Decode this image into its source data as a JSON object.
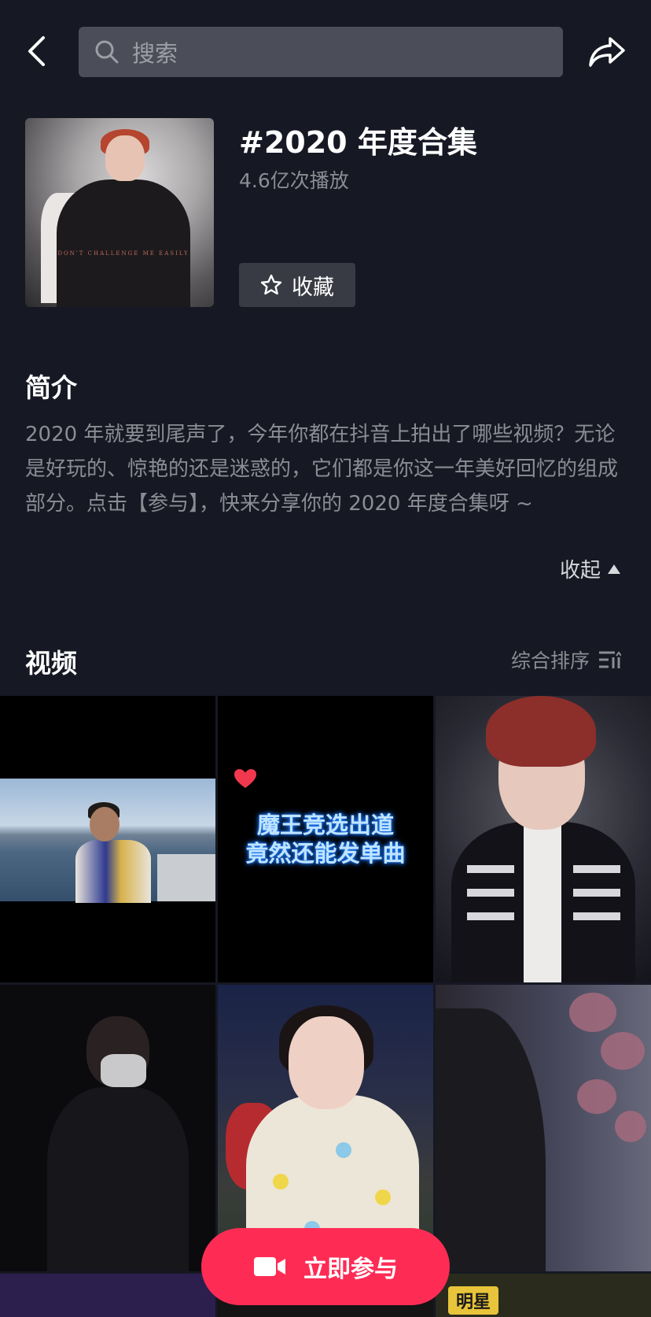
{
  "header": {
    "back_icon": "chevron-left-icon",
    "search_placeholder": "搜索",
    "share_icon": "share-arrow-icon"
  },
  "topic": {
    "title": "#2020 年度合集",
    "plays": "4.6亿次播放",
    "favorite_label": "收藏",
    "cover_tagline": "DON'T CHALLENGE ME EASILY"
  },
  "intro": {
    "heading": "简介",
    "text": "2020 年就要到尾声了，今年你都在抖音上拍出了哪些视频？无论是好玩的、惊艳的还是迷惑的，它们都是你这一年美好回忆的组成部分。点击【参与】，快来分享你的 2020 年度合集呀 ~",
    "collapse_label": "收起"
  },
  "videos": {
    "heading": "视频",
    "sort_label": "综合排序",
    "promo_text_line1": "魔王竞选出道",
    "promo_text_line2": "竟然还能发单曲",
    "badge_label": "明星"
  },
  "cta": {
    "join_label": "立即参与"
  },
  "colors": {
    "background": "#161823",
    "accent": "#fe2c55",
    "secondary_text": "#8b8d94"
  }
}
